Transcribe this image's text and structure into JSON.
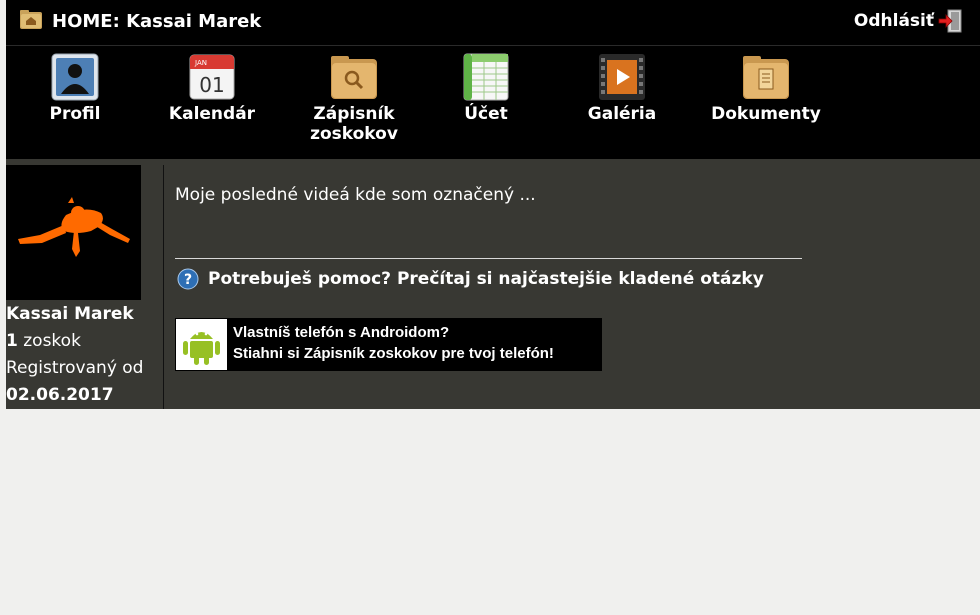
{
  "header": {
    "home_prefix": "HOME:",
    "user_name": "Kassai Marek",
    "logout_label": "Odhlásiť",
    "home_icon": "home-folder-icon",
    "logout_icon": "logout-door-icon"
  },
  "menu": {
    "items": [
      {
        "label": "Profil",
        "icon": "profile-icon"
      },
      {
        "label": "Kalendár",
        "icon": "calendar-icon",
        "calendar_month": "JAN",
        "calendar_day": "01"
      },
      {
        "label": "Zápisník\nzoskokov",
        "icon": "logbook-folder-icon"
      },
      {
        "label": "Účet",
        "icon": "spreadsheet-icon"
      },
      {
        "label": "Galéria",
        "icon": "film-icon"
      },
      {
        "label": "Dokumenty",
        "icon": "documents-folder-icon"
      }
    ]
  },
  "sidebar": {
    "name": "Kassai Marek",
    "jumps_count": "1",
    "jumps_label": "zoskok",
    "registered_label": "Registrovaný od",
    "registered_date": "02.06.2017",
    "avatar_icon": "skydiver-avatar-icon"
  },
  "main": {
    "videos_text": "Moje posledné videá kde som označený ...",
    "help_text": "Potrebuješ pomoc? Prečítaj si najčastejšie kladené otázky",
    "help_icon": "question-icon",
    "android_line1": "Vlastníš telefón s Androidom?",
    "android_line2": "Stiahni si Zápisník zoskokov pre tvoj telefón!",
    "android_icon": "android-icon"
  },
  "colors": {
    "background": "#383833",
    "bar": "#000000",
    "text": "#ffffff",
    "avatar_orange": "#ff6a00"
  }
}
